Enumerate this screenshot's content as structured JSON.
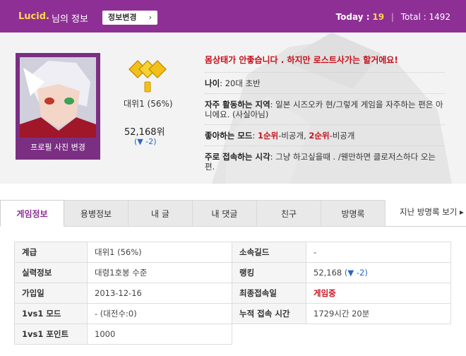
{
  "header": {
    "username": "Lucid.",
    "suffix": "님의 정보",
    "edit_button": "정보변경",
    "today_label": "Today :",
    "today_value": "19",
    "separator": "|",
    "total": "Total : 1492"
  },
  "profile": {
    "change_photo": "프로필 사진 변경",
    "rank_label": "대위1 (56%)",
    "rank_number": "52,168위",
    "rank_delta": "(▼ -2)",
    "motto": "몸상태가 안좋습니다 . 하지만 로스트사가는 할거에요!",
    "age_key": "나이",
    "age_value": ": 20대 초반",
    "region_key": "자주 활동하는 지역",
    "region_value": ": 일본 시즈오카 현/그렇게 게임을 자주하는 편은 아니에요. (사실아님)",
    "mode_key": "좋아하는 모드",
    "mode_colon": ": ",
    "mode_first": "1순위",
    "mode_first_rest": "-비공개, ",
    "mode_second": "2순위",
    "mode_second_rest": "-비공개",
    "time_key": "주로 접속하는 시각",
    "time_value": ": 그냥 하고싶을때 . /웬만하면 클로저스하다 오는편."
  },
  "tabs": [
    "게임정보",
    "용병정보",
    "내 글",
    "내 댓글",
    "친구",
    "방명록"
  ],
  "guestbook_link": "지난 방명록 보기 ▸",
  "table": {
    "rank_h": "계급",
    "rank_v": "대위1 (56%)",
    "guild_h": "소속길드",
    "guild_v": "-",
    "skill_h": "실력정보",
    "skill_v": "대령1호봉 수준",
    "ranking_h": "랭킹",
    "ranking_v": "52,168",
    "ranking_delta": "(▼ -2)",
    "join_h": "가입일",
    "join_v": "2013-12-16",
    "last_h": "최종접속일",
    "last_v": "게임중",
    "mode_h": "1vs1 모드",
    "mode_v": "- (대전수:0)",
    "time_h": "누적 접속 시간",
    "time_v": "1729시간 20분",
    "point_h": "1vs1 포인트",
    "point_v": "1000"
  }
}
